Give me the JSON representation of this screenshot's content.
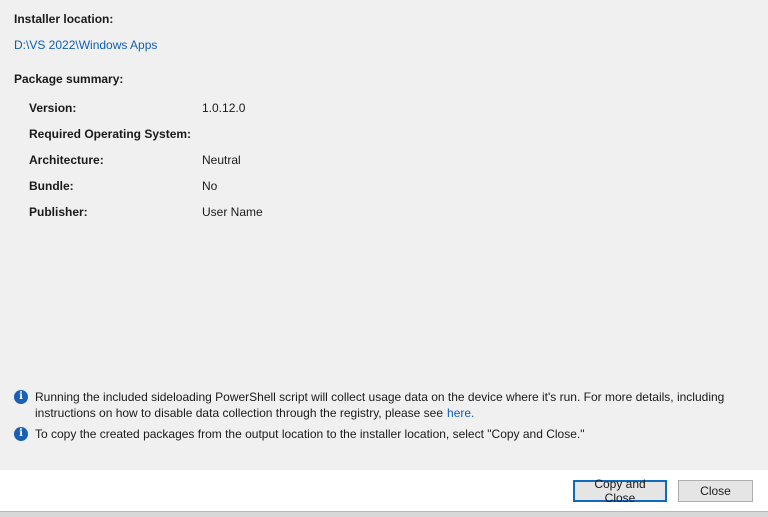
{
  "installer": {
    "label": "Installer location:",
    "path": "D:\\VS 2022\\Windows Apps"
  },
  "summary": {
    "label": "Package summary:",
    "rows": [
      {
        "key": "Version:",
        "value": "1.0.12.0"
      },
      {
        "key": "Required Operating System:",
        "value": ""
      },
      {
        "key": "Architecture:",
        "value": "Neutral"
      },
      {
        "key": "Bundle:",
        "value": "No"
      },
      {
        "key": "Publisher:",
        "value": "User Name"
      }
    ]
  },
  "info": {
    "telemetry_line1": "Running the included sideloading PowerShell script will collect usage data on the device where it's run.  For more details, including",
    "telemetry_line2": "instructions on how to disable data collection through the registry, please see",
    "telemetry_link": "here.",
    "copy_notice": "To copy the created packages from the output location to the installer location, select \"Copy and Close.\""
  },
  "buttons": {
    "copy_and_close": "Copy and Close",
    "close": "Close"
  },
  "colors": {
    "link": "#0f5fb5",
    "info_icon": "#1a5fb4",
    "primary_border": "#0f6cbd"
  },
  "icons": {
    "info": "info-icon"
  }
}
